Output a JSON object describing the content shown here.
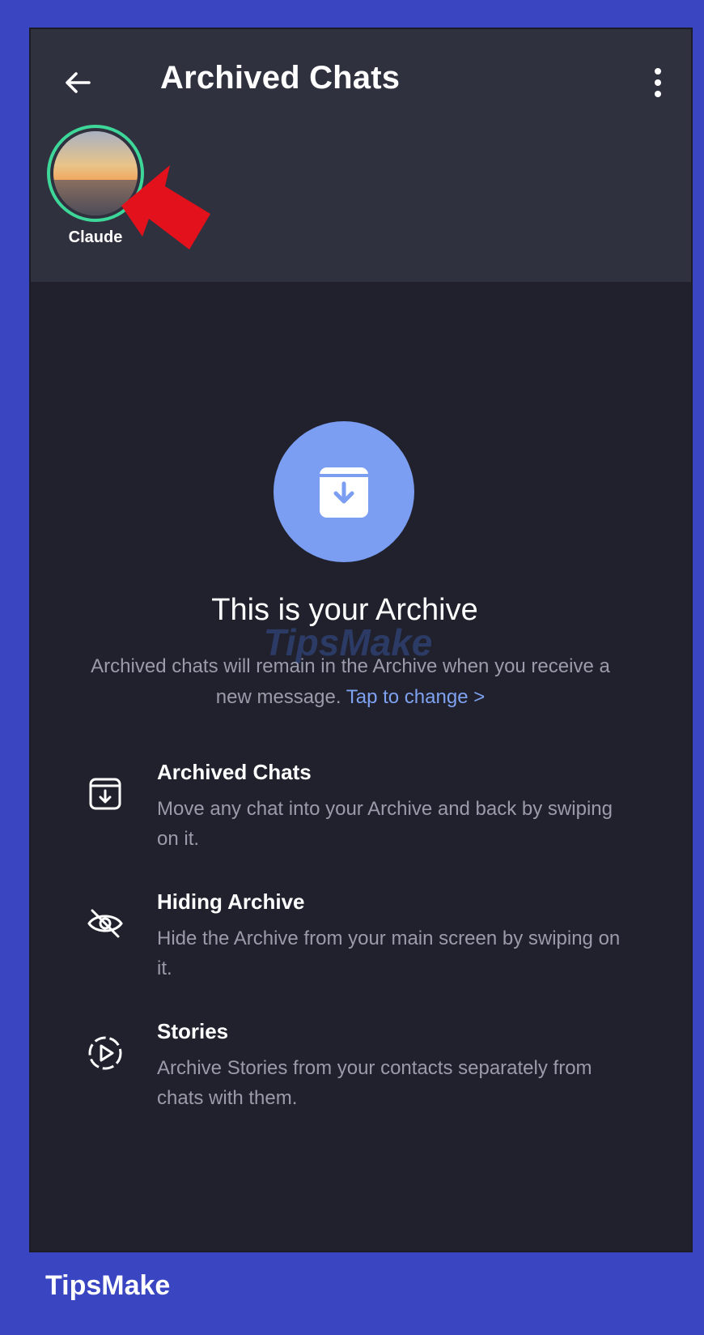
{
  "header": {
    "title": "Archived Chats",
    "back_icon": "arrow-left-icon",
    "menu_icon": "more-vertical-icon"
  },
  "stories": [
    {
      "name": "Claude",
      "ring_color": "#3ed79a"
    }
  ],
  "empty_state": {
    "icon": "archive-box-icon",
    "icon_bg": "#7b9ef3",
    "headline": "This is your Archive",
    "description": "Archived chats will remain in the Archive when you receive a new message.",
    "link": "Tap to change >"
  },
  "features": [
    {
      "icon": "archive-icon",
      "title": "Archived Chats",
      "description": "Move any chat into your Archive and back by swiping on it."
    },
    {
      "icon": "eye-off-icon",
      "title": "Hiding Archive",
      "description": "Hide the Archive from your main screen by swiping on it."
    },
    {
      "icon": "play-story-icon",
      "title": "Stories",
      "description": "Archive Stories from your contacts separately from chats with them."
    }
  ],
  "watermark": "TipsMake",
  "brand": "TipsMake",
  "colors": {
    "frame": "#3a45c2",
    "app_bg": "#20212c",
    "header_bg": "#30313f",
    "link": "#7ea2f0"
  }
}
